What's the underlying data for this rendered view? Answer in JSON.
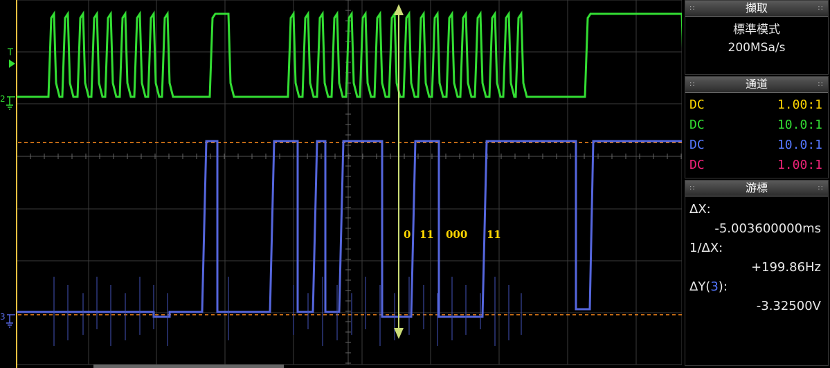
{
  "markers": {
    "trigger": "T",
    "ch2_ground": "2",
    "ch3_ground": "3"
  },
  "annotation_bits": [
    "0",
    "11",
    "000",
    "11"
  ],
  "acquisition": {
    "title": "擷取",
    "mode": "標準模式",
    "rate": "200MSa/s"
  },
  "channels": {
    "title": "通道",
    "rows": [
      {
        "coupling": "DC",
        "probe": "1.00:1",
        "color": "#ffd700"
      },
      {
        "coupling": "DC",
        "probe": "10.0:1",
        "color": "#33dd33"
      },
      {
        "coupling": "DC",
        "probe": "10.0:1",
        "color": "#5577ff"
      },
      {
        "coupling": "DC",
        "probe": "1.00:1",
        "color": "#ee2277"
      }
    ]
  },
  "cursors": {
    "title": "游標",
    "dx_label": "ΔX:",
    "dx_value": "-5.003600000ms",
    "inv_label": "1/ΔX:",
    "inv_value": "+199.86Hz",
    "dy_label_prefix": "ΔY(",
    "dy_channel": "3",
    "dy_label_suffix": "):",
    "dy_value": "-3.32500V"
  },
  "colors": {
    "ch2": "#33dd33",
    "ch3": "#5566dd",
    "cursor_h": "#ff8c1a",
    "cursor_v": "#ccdd77"
  }
}
